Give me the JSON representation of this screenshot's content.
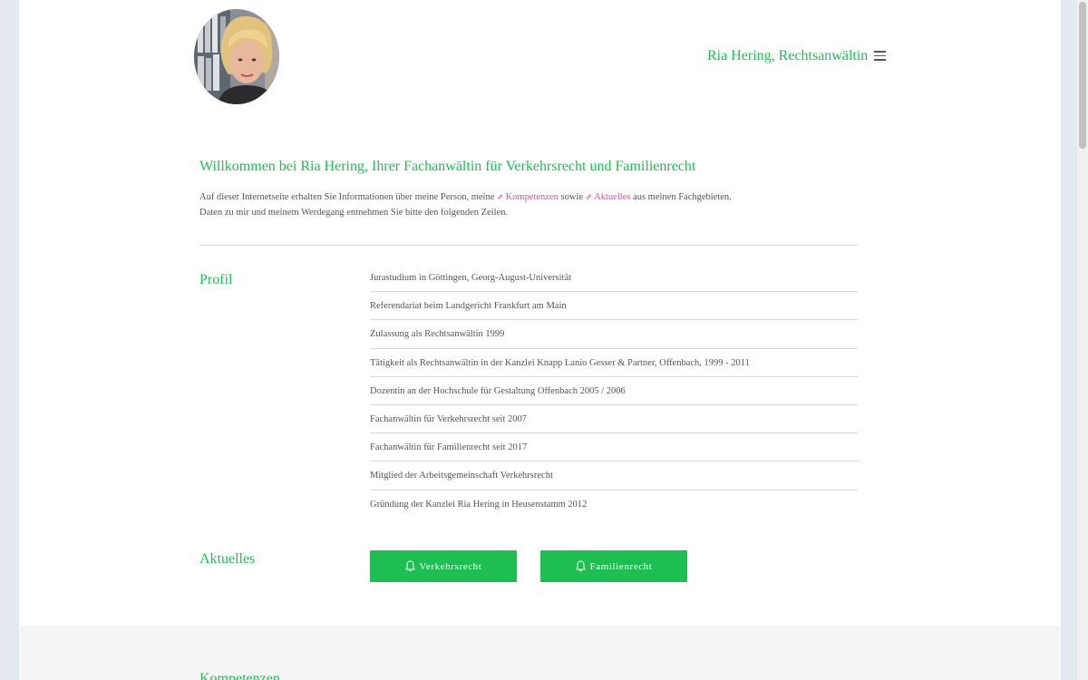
{
  "header": {
    "site_title": "Ria Hering, Rechtsanwältin",
    "menu_icon": "hamburger-menu-icon",
    "avatar": "portrait-photo"
  },
  "intro": {
    "heading": "Willkommen bei Ria Hering, Ihrer Fachanwältin für Verkehrsrecht und Familienrecht",
    "line1_part1": "Auf dieser Internetseite erhalten Sie Informationen über meine Person, meine ",
    "link_kompetenzen": "Kompetenzen",
    "line1_part2": " sowie ",
    "link_aktuelles": "Aktuelles",
    "line1_part3": " aus meinen Fachgebieten.",
    "line2": "Daten zu mir und meinem Werdegang entnehmen Sie bitte den folgenden Zeilen.",
    "link_icon": "arrow-link-icon"
  },
  "profil": {
    "label": "Profil",
    "items": [
      "Jurastudium in Göttingen, Georg-August-Universität",
      "Referendariat beim Landgericht Frankfurt am Main",
      "Zulassung als Rechtsanwältin 1999",
      "Tätigkeit als Rechtsanwältin in der Kanzlei Knapp Lanio Gesser & Partner, Offenbach, 1999 - 2011",
      "Dozentin an der Hochschule für Gestaltung Offenbach 2005 / 2006",
      "Fachanwältin für Verkehrsrecht seit 2007",
      "Fachanwältin für Familienrecht seit 2017",
      "Mitglied der Arbeitsgemeinschaft Verkehrsrecht",
      "Gründung der Kanzlei Ria Hering in Heusenstamm 2012"
    ]
  },
  "aktuelles": {
    "label": "Aktuelles",
    "buttons": [
      {
        "label": "Verkehrsrecht",
        "icon": "bell-icon"
      },
      {
        "label": "Familienrecht",
        "icon": "bell-icon"
      }
    ]
  },
  "kompetenzen": {
    "label": "Kompetenzen"
  },
  "colors": {
    "accent": "#1fbe53",
    "link": "#e04ab5",
    "text": "#555555"
  }
}
